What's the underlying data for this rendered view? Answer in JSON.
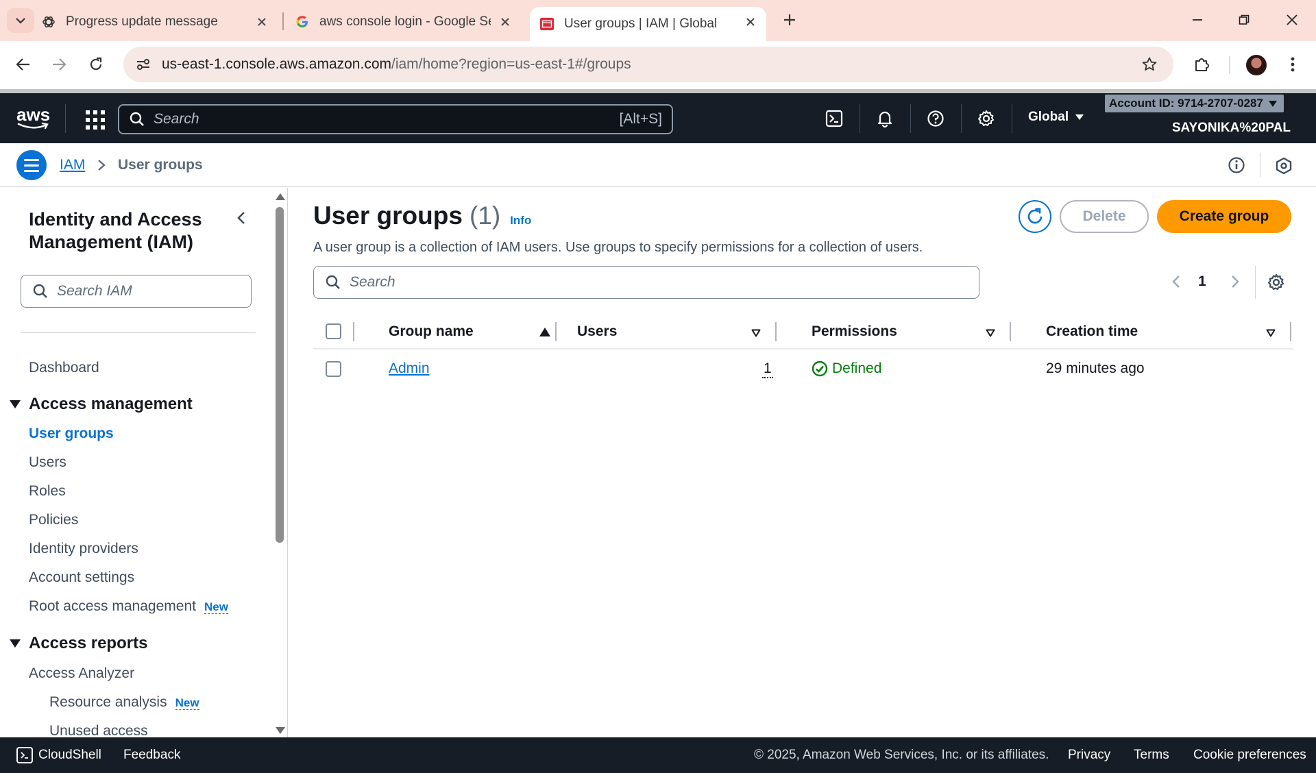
{
  "browser": {
    "tabs": [
      {
        "title": "Progress update message",
        "icon": "openai-icon"
      },
      {
        "title": "aws console login - Google Sea",
        "icon": "google-icon"
      },
      {
        "title": "User groups | IAM | Global",
        "icon": "aws-console-icon"
      }
    ],
    "url_host": "us-east-1.console.aws.amazon.com",
    "url_path": "/iam/home?region=us-east-1#/groups"
  },
  "aws_nav": {
    "logo": "aws",
    "search_placeholder": "Search",
    "search_shortcut": "[Alt+S]",
    "region": "Global",
    "account_id": "Account ID: 9714-2707-0287",
    "username": "SAYONIKA%20PAL"
  },
  "breadcrumb": {
    "root": "IAM",
    "current": "User groups"
  },
  "sidebar": {
    "title": "Identity and Access Management (IAM)",
    "search_placeholder": "Search IAM",
    "dashboard": "Dashboard",
    "section_access_management": "Access management",
    "items": [
      "User groups",
      "Users",
      "Roles",
      "Policies",
      "Identity providers",
      "Account settings",
      "Root access management"
    ],
    "new_badge": "New",
    "section_access_reports": "Access reports",
    "access_analyzer": "Access Analyzer",
    "sub_items": [
      "Resource analysis",
      "Unused access"
    ]
  },
  "main": {
    "title": "User groups",
    "count": "(1)",
    "info": "Info",
    "description": "A user group is a collection of IAM users. Use groups to specify permissions for a collection of users.",
    "delete_label": "Delete",
    "create_label": "Create group",
    "search_placeholder": "Search",
    "page_number": "1",
    "columns": [
      "Group name",
      "Users",
      "Permissions",
      "Creation time"
    ],
    "rows": [
      {
        "group_name": "Admin",
        "users": "1",
        "permissions": "Defined",
        "creation_time": "29 minutes ago"
      }
    ]
  },
  "footer": {
    "cloudshell": "CloudShell",
    "feedback": "Feedback",
    "copyright": "© 2025, Amazon Web Services, Inc. or its affiliates.",
    "privacy": "Privacy",
    "terms": "Terms",
    "cookie": "Cookie preferences"
  },
  "colors": {
    "aws_dark": "#161d26",
    "link_blue": "#0972d3",
    "primary_orange": "#ff9900",
    "success_green": "#037f0c",
    "tab_strip": "#fbe0da"
  }
}
